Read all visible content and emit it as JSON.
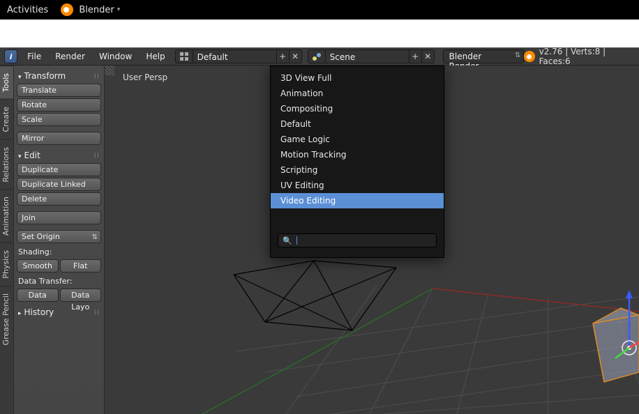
{
  "os_bar": {
    "activities": "Activities",
    "app_name": "Blender"
  },
  "header": {
    "menus": [
      "File",
      "Render",
      "Window",
      "Help"
    ],
    "layout_value": "Default",
    "scene_value": "Scene",
    "engine": "Blender Render",
    "stats": "v2.76 | Verts:8 | Faces:6"
  },
  "viewport": {
    "persp": "User Persp"
  },
  "vtabs": [
    "Tools",
    "Create",
    "Relations",
    "Animation",
    "Physics",
    "Grease Pencil"
  ],
  "tool_panel": {
    "transform": {
      "title": "Transform",
      "btns": [
        "Translate",
        "Rotate",
        "Scale",
        "Mirror"
      ]
    },
    "edit": {
      "title": "Edit",
      "btns": [
        "Duplicate",
        "Duplicate Linked",
        "Delete",
        "Join"
      ],
      "set_origin": "Set Origin",
      "shading_label": "Shading:",
      "shading": [
        "Smooth",
        "Flat"
      ],
      "dt_label": "Data Transfer:",
      "dt": [
        "Data",
        "Data Layo"
      ]
    },
    "history": {
      "title": "History"
    }
  },
  "popup": {
    "items": [
      "3D View Full",
      "Animation",
      "Compositing",
      "Default",
      "Game Logic",
      "Motion Tracking",
      "Scripting",
      "UV Editing",
      "Video Editing"
    ],
    "selected_index": 8
  }
}
